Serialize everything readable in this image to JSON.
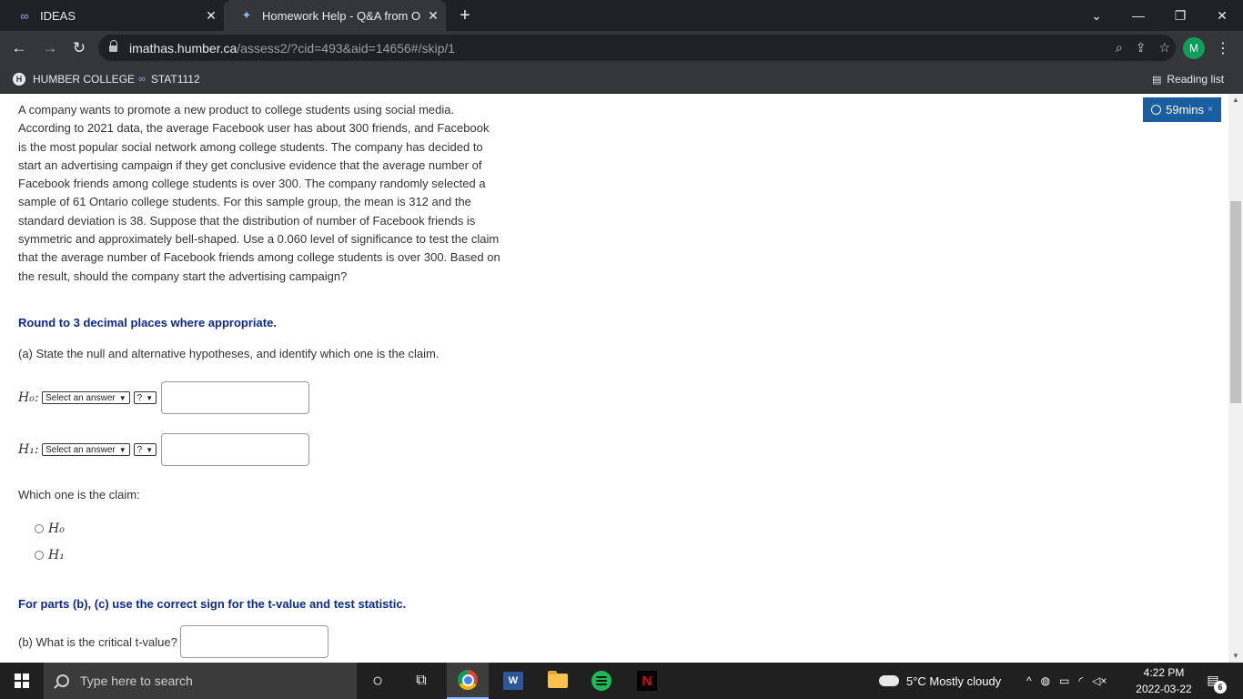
{
  "browser": {
    "tabs": [
      {
        "title": "IDEAS",
        "favicon": "infinity-icon",
        "active": false
      },
      {
        "title": "Homework Help - Q&A from Onl",
        "favicon": "chegg-icon",
        "active": true
      }
    ],
    "new_tab_label": "+",
    "url_host": "imathas.humber.ca",
    "url_path": "/assess2/?cid=493&aid=14656#/skip/1",
    "profile_initial": "M",
    "bookmarks": [
      {
        "label": "HUMBER COLLEGE",
        "icon": "humber-icon"
      },
      {
        "label": "STAT1112",
        "icon": "infinity-icon"
      }
    ],
    "reading_list_label": "Reading list"
  },
  "assessment": {
    "timer_label": "59mins",
    "timer_close": "×",
    "question_text": "A company wants to promote a new product to college students using social media. According to 2021 data, the average Facebook user has about 300 friends, and Facebook is the most popular social network among college students. The company has decided to start an advertising campaign if they get conclusive evidence that the average number of Facebook friends among college students is over 300. The company randomly selected a sample of 61 Ontario college students. For this sample group, the mean is 312 and the standard deviation is 38. Suppose that the distribution of number of Facebook friends is symmetric and approximately bell-shaped. Use a 0.060 level of significance to test the claim that the average number of Facebook friends among college students is over 300. Based on the result, should the company start the advertising campaign?",
    "round_note": "Round to 3 decimal places where appropriate.",
    "part_a": "(a) State the null and alternative hypotheses, and identify which one is the claim.",
    "h0_label": "H₀:",
    "h1_label": "H₁:",
    "select_placeholder": "Select an answer",
    "sign_placeholder": "?",
    "claim_question": "Which one is the claim:",
    "claim_options": [
      "H₀",
      "H₁"
    ],
    "parts_bc_note": "For parts (b), (c) use the correct sign for the t-value and test statistic.",
    "part_b": "(b) What is the critical t-value?"
  },
  "taskbar": {
    "search_placeholder": "Type here to search",
    "weather": "5°C  Mostly cloudy",
    "time": "4:22 PM",
    "date": "2022-03-22",
    "notification_count": "6"
  }
}
